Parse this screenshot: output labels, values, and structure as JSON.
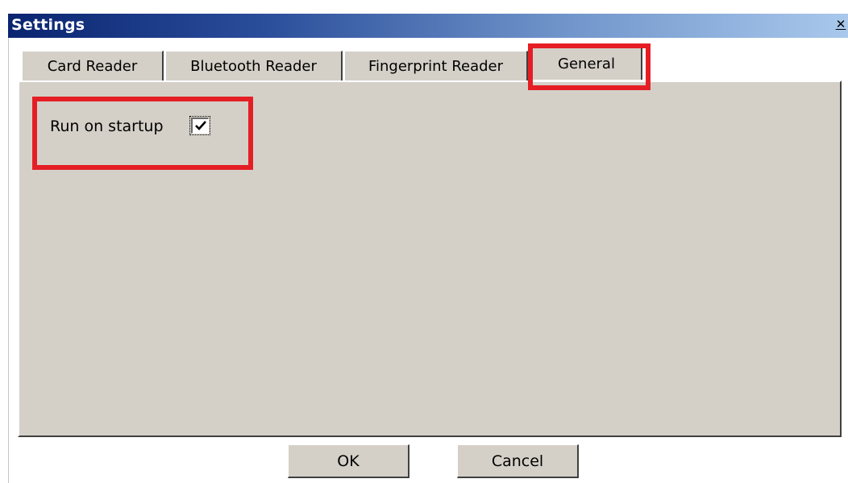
{
  "window": {
    "title": "Settings",
    "close_glyph": "✕"
  },
  "tabs": [
    {
      "label": "Card Reader"
    },
    {
      "label": "Bluetooth Reader"
    },
    {
      "label": "Fingerprint Reader"
    },
    {
      "label": "General",
      "selected": true
    }
  ],
  "general": {
    "run_on_startup_label": "Run on startup",
    "run_on_startup_checked": true
  },
  "buttons": {
    "ok_label": "OK",
    "cancel_label": "Cancel"
  },
  "icons": {
    "close": "close-icon",
    "check": "check-icon"
  },
  "colors": {
    "highlight": "#e51e25",
    "panel": "#d4d0c8",
    "titlebar_start": "#0a2470",
    "titlebar_end": "#a9c8ec"
  }
}
